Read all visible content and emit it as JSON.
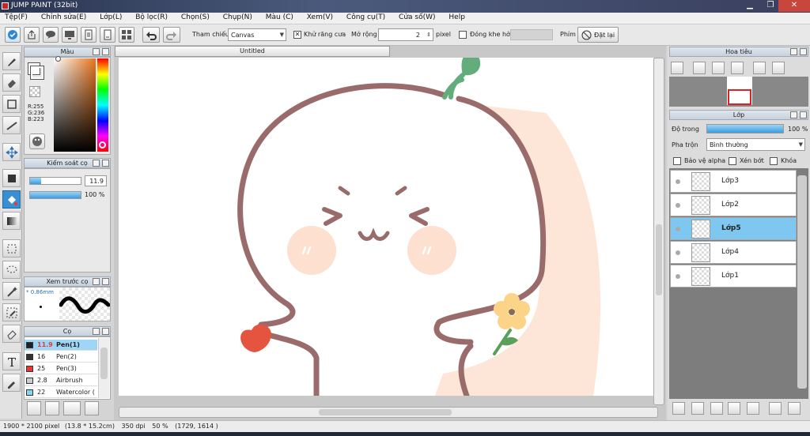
{
  "window": {
    "title": "JUMP PAINT (32bit)",
    "min": "▁",
    "max": "❐",
    "close": "✕"
  },
  "menu": [
    "Tệp(F)",
    "Chỉnh sửa(E)",
    "Lớp(L)",
    "Bộ lọc(R)",
    "Chọn(S)",
    "Chụp(N)",
    "Màu (C)",
    "Xem(V)",
    "Công cụ(T)",
    "Cửa số(W)",
    "Help"
  ],
  "toolbar": {
    "reference_label": "Tham chiếu",
    "reference_value": "Canvas",
    "antialias_label": "Khử răng cưa",
    "expand_label": "Mở rộng",
    "expand_value": "2",
    "expand_unit": "pixel",
    "close_gap_label": "Đóng khe hở",
    "key_label": "Phím",
    "reset_label": "Đặt lại"
  },
  "color_panel": {
    "title": "Màu",
    "r": "R:255",
    "g": "G:236",
    "b": "B:223",
    "fg": "#e53935",
    "bg": "#ffffff"
  },
  "brush_control": {
    "title": "Kiểm soát cọ",
    "size": "11.9",
    "opacity": "100 %",
    "opacity_fill": 1.0
  },
  "brush_preview": {
    "title": "Xem trước cọ",
    "size": "0.86mm"
  },
  "brushes": {
    "title": "Cọ",
    "items": [
      {
        "size": "11.9",
        "name": "Pen(1)",
        "color": "#222222"
      },
      {
        "size": "16",
        "name": "Pen(2)",
        "color": "#333333"
      },
      {
        "size": "25",
        "name": "Pen(3)",
        "color": "#e53935"
      },
      {
        "size": "2.8",
        "name": "Airbrush",
        "color": "#cccccc"
      },
      {
        "size": "22",
        "name": "Watercolor (",
        "color": "#7fd8ee"
      }
    ]
  },
  "document": {
    "tab": "Untitled"
  },
  "navigator": {
    "title": "Hoa tiêu"
  },
  "layers": {
    "title": "Lớp",
    "opacity_label": "Độ trong",
    "opacity_value": "100 %",
    "opacity_fill": 1.0,
    "blend_label": "Pha trộn",
    "blend_value": "Bình thường",
    "protect_alpha": "Bảo vệ alpha",
    "clipping": "Xén bớt",
    "lock": "Khóa",
    "items": [
      {
        "name": "Lớp3",
        "selected": false
      },
      {
        "name": "Lớp2",
        "selected": false
      },
      {
        "name": "Lớp5",
        "selected": true
      },
      {
        "name": "Lớp4",
        "selected": false
      },
      {
        "name": "Lớp1",
        "selected": false
      }
    ]
  },
  "status": {
    "size": "1900 * 2100 pixel",
    "dims": "(13.8 * 15.2cm)",
    "dpi": "350 dpi",
    "zoom": "50 %",
    "coords": "(1729, 1614 )"
  }
}
